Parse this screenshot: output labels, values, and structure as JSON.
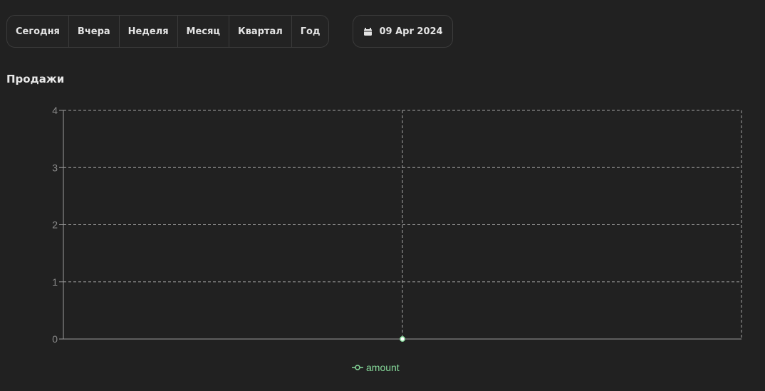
{
  "toolbar": {
    "periods": [
      "Сегодня",
      "Вчера",
      "Неделя",
      "Месяц",
      "Квартал",
      "Год"
    ],
    "date_label": "09 Apr 2024",
    "date_icon": "calendar-icon"
  },
  "section": {
    "title": "Продажи"
  },
  "colors": {
    "background": "#212121",
    "grid": "#cfcfcf",
    "axis_text": "#8a8a8a",
    "series": "#86d99a"
  },
  "chart_data": {
    "type": "line",
    "title": "",
    "xlabel": "",
    "ylabel": "",
    "ylim": [
      0,
      4
    ],
    "yticks": [
      0,
      1,
      2,
      3,
      4
    ],
    "grid": true,
    "legend": "bottom",
    "series": [
      {
        "name": "amount",
        "values": [
          0
        ]
      }
    ]
  }
}
